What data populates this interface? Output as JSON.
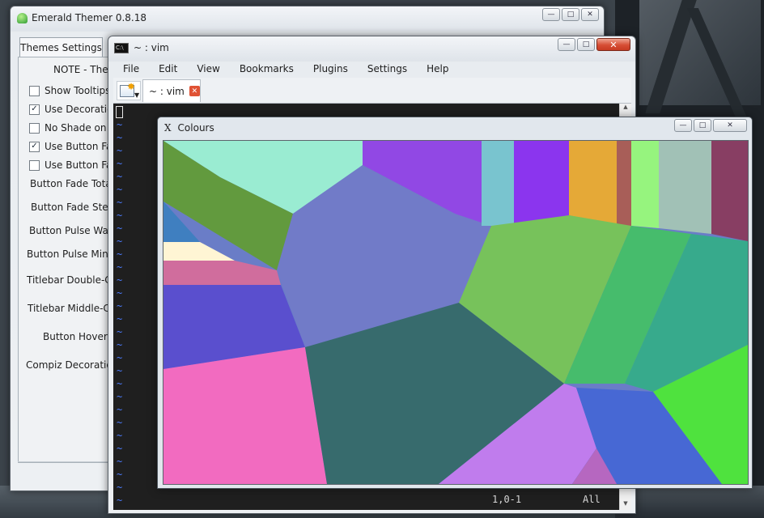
{
  "emerald": {
    "title": "Emerald Themer 0.8.18",
    "tab": "Themes Settings",
    "note": "NOTE - Thes",
    "checkboxes": [
      {
        "label": "Show Tooltips",
        "checked": false
      },
      {
        "label": "Use Decoration",
        "checked": true
      },
      {
        "label": "No Shade on T",
        "checked": false
      },
      {
        "label": "Use Button Fac",
        "checked": true
      },
      {
        "label": "Use Button Fac",
        "checked": false
      }
    ],
    "labels": [
      "Button Fade Total",
      "Button Fade Step",
      "Button Pulse Wait",
      "Button Pulse Min C",
      "Titlebar Double-Cli",
      "Titlebar Middle-Cli",
      "Button Hover C",
      "Compiz Decoration"
    ]
  },
  "vim": {
    "title": "~ : vim",
    "menu": [
      "File",
      "Edit",
      "View",
      "Bookmarks",
      "Plugins",
      "Settings",
      "Help"
    ],
    "tab_label": "~ : vim",
    "tilde": "~",
    "status_pos": "1,0-1",
    "status_all": "All"
  },
  "colours": {
    "title": "Colours",
    "icon_glyph": "X",
    "accent": "#e05234"
  },
  "icons": {
    "app": "emerald-icon",
    "terminal": "terminal-icon",
    "x11": "x-icon",
    "new_tab": "new-tab-icon"
  }
}
